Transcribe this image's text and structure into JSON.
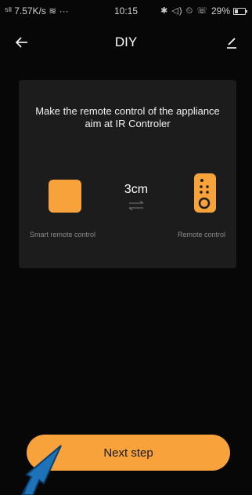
{
  "status_bar": {
    "signal_speed": "7.57K/s",
    "time": "10:15",
    "battery": "29%"
  },
  "header": {
    "title": "DIY",
    "back_icon": "arrow-left-icon",
    "edit_icon": "pencil-icon"
  },
  "card": {
    "instruction": "Make the remote control of the appliance aim at IR Controler",
    "distance": "3cm",
    "left_device_label": "Smart remote control",
    "right_device_label": "Remote control"
  },
  "footer": {
    "next_label": "Next step"
  },
  "colors": {
    "accent": "#f7a23a",
    "background": "#070707",
    "card": "#1c1c1c"
  }
}
